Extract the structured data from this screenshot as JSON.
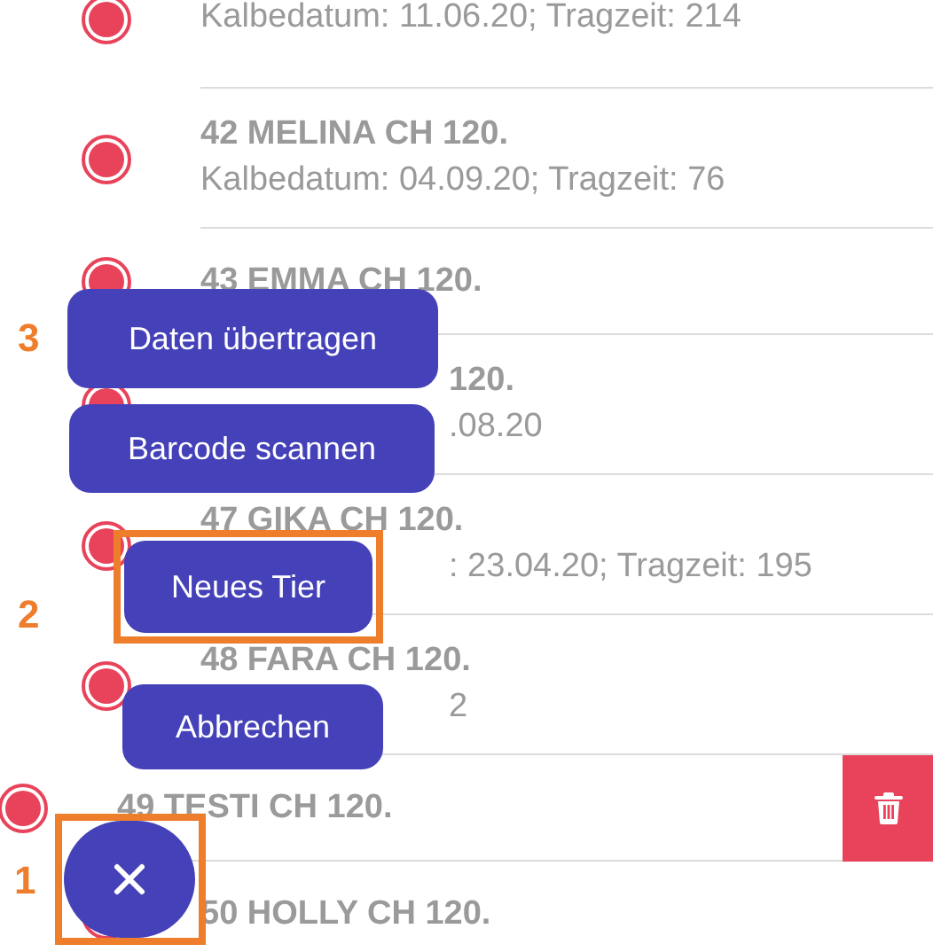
{
  "list": {
    "rows": [
      {
        "subtitle": "Kalbedatum: 11.06.20; Tragzeit: 214",
        "swiped": false
      },
      {
        "title": "42 MELINA CH 120.",
        "subtitle": "Kalbedatum: 04.09.20; Tragzeit: 76",
        "swiped": false
      },
      {
        "title": "43 EMMA CH 120.",
        "swiped": false
      },
      {
        "title": "120.",
        "subtitle": ".08.20",
        "swiped": false
      },
      {
        "title": "47 GIKA CH 120.",
        "subtitle": ": 23.04.20; Tragzeit: 195",
        "swiped": false
      },
      {
        "title": "48 FARA CH 120.",
        "subtitle": "2",
        "swiped": false
      },
      {
        "title": "49 TESTI CH 120.",
        "swiped": true
      },
      {
        "title": "50 HOLLY CH 120.",
        "swiped": false
      }
    ]
  },
  "menu": {
    "actions": [
      {
        "label": "Daten übertragen",
        "highlighted": false,
        "marker": "3"
      },
      {
        "label": "Barcode scannen",
        "highlighted": false
      },
      {
        "label": "Neues Tier",
        "highlighted": true,
        "marker": "2"
      },
      {
        "label": "Abbrechen",
        "highlighted": false
      }
    ],
    "fab": {
      "highlighted": true,
      "marker": "1"
    }
  }
}
